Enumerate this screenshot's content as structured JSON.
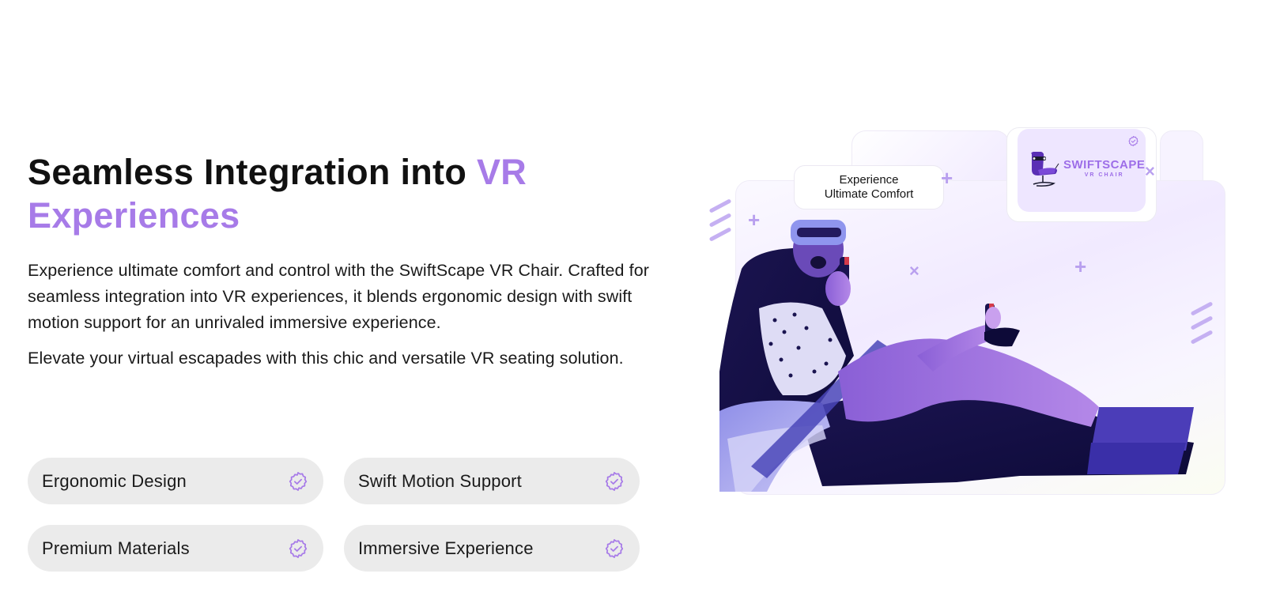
{
  "heading": {
    "text_main": "Seamless Integration into ",
    "text_accent_1": "VR",
    "text_accent_2": "Experiences"
  },
  "description": {
    "paragraph_1": "Experience ultimate comfort and control with the SwiftScape VR Chair. Crafted for seamless integration into VR experiences, it blends ergonomic design with swift motion support for an unrivaled immersive experience.",
    "paragraph_2": "Elevate your virtual escapades with this chic and versatile VR seating solution."
  },
  "features": [
    {
      "label": "Ergonomic Design",
      "icon": "badge-check-icon"
    },
    {
      "label": "Swift Motion Support",
      "icon": "badge-check-icon"
    },
    {
      "label": "Premium Materials",
      "icon": "badge-check-icon"
    },
    {
      "label": "Immersive Experience",
      "icon": "badge-check-icon"
    }
  ],
  "visual": {
    "callout_line_1": "Experience",
    "callout_line_2": "Ultimate Comfort",
    "logo_name": "SWIFTSCAPE",
    "logo_sub": "VR CHAIR",
    "image_alt": "Woman wearing VR headset in racing-style VR chair holding joysticks"
  },
  "colors": {
    "accent": "#a77be8",
    "pill_bg": "#ebebeb",
    "text": "#151515"
  }
}
